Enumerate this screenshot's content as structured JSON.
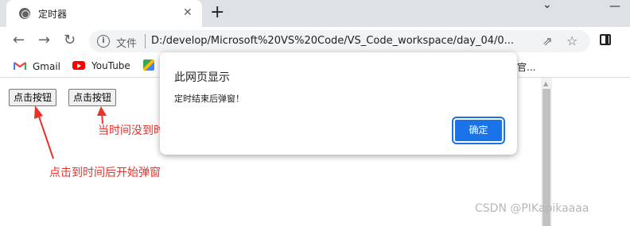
{
  "browser": {
    "tab": {
      "title": "定时器",
      "close": "✕"
    },
    "new_tab": "+",
    "window_controls": {
      "chevron": "⌄",
      "minimize": "—"
    },
    "nav": {
      "back": "←",
      "forward": "→",
      "reload": "↻"
    },
    "omnibox": {
      "info_icon": "i",
      "scheme_label": "文件",
      "url": "D:/develop/Microsoft%20VS%20Code/VS_Code_workspace/day_04/0...",
      "share_icon": "⇗",
      "star_icon": "☆"
    },
    "bookmarks": [
      {
        "label": "Gmail",
        "icon": "gmail-icon"
      },
      {
        "label": "YouTube",
        "icon": "youtube-icon"
      },
      {
        "label": "",
        "icon": "maps-icon"
      }
    ],
    "bookmark_overflow": "官..."
  },
  "page": {
    "buttons": [
      "点击按钮",
      "点击按钮"
    ],
    "scroll_up": "▲",
    "annotations": {
      "start_popup": "点击到时间后开始弹窗",
      "clear_timer": "当时间没到时候点击，清除计时器，则不弹窗"
    },
    "watermark": "CSDN @PIKapikaaaa",
    "annotation_color": "#e8322a"
  },
  "dialog": {
    "title": "此网页显示",
    "message": "定时结束后弹窗！",
    "ok_label": "确定",
    "ok_color": "#1a73e8"
  }
}
